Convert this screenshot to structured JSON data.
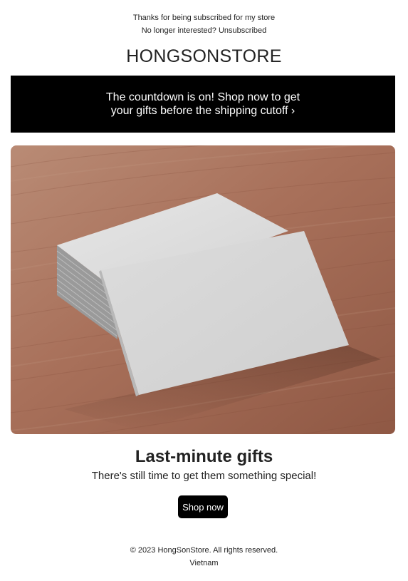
{
  "header": {
    "thanks_text": "Thanks for being subscribed for my store",
    "unsubscribe_prompt": "No longer interested?",
    "unsubscribe_link": "Unsubscribed",
    "store_name": "HONGSONSTORE"
  },
  "banner": {
    "text": "The countdown is on! Shop now to get your gifts before the shipping cutoff ›"
  },
  "hero": {
    "image_alt": "Stack of blank business cards on a wooden table"
  },
  "promo": {
    "headline": "Last-minute gifts",
    "subline": "There's still time to get them something special!",
    "cta_label": "Shop now"
  },
  "footer": {
    "copyright": "© 2023 HongSonStore. All rights reserved.",
    "country": "Vietnam"
  },
  "colors": {
    "banner_bg": "#000000",
    "button_bg": "#000000",
    "text": "#222222",
    "wood": "#a0664e"
  }
}
